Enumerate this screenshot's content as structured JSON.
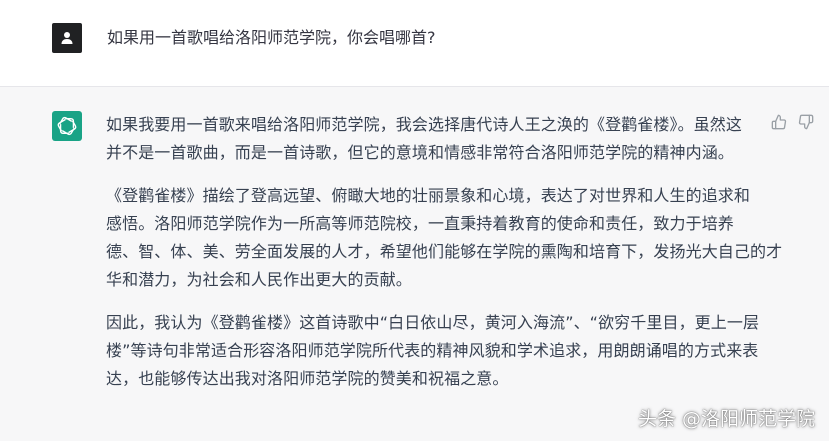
{
  "user_message": {
    "text": "如果用一首歌唱给洛阳师范学院，你会唱哪首?"
  },
  "assistant_message": {
    "paragraphs": [
      {
        "lines": [
          "如果我要用一首歌来唱给洛阳师范学院，我会选择唐代诗人王之涣的《登鹳雀楼》。虽然这",
          "并不是一首歌曲，而是一首诗歌，但它的意境和情感非常符合洛阳师范学院的精神内涵。"
        ]
      },
      {
        "lines": [
          "《登鹳雀楼》描绘了登高远望、俯瞰大地的壮丽景象和心境，表达了对世界和人生的追求和",
          "感悟。洛阳师范学院作为一所高等师范院校，一直秉持着教育的使命和责任，致力于培养",
          "德、智、体、美、劳全面发展的人才，希望他们能够在学院的熏陶和培育下，发扬光大自己的才",
          "华和潜力，为社会和人民作出更大的贡献。"
        ]
      },
      {
        "lines": [
          "因此，我认为《登鹳雀楼》这首诗歌中“白日依山尽，黄河入海流”、“欲穷千里目，更上一层",
          "楼”等诗句非常适合形容洛阳师范学院所代表的精神风貌和学术追求，用朗朗诵唱的方式来表",
          "达，也能够传达出我对洛阳师范学院的赞美和祝福之意。"
        ]
      }
    ]
  },
  "feedback": {
    "thumbs_up_icon": "thumbs-up-icon",
    "thumbs_down_icon": "thumbs-down-icon"
  },
  "watermark": {
    "text": "头条 @洛阳师范学院"
  },
  "colors": {
    "user_avatar_bg": "#202123",
    "assistant_avatar_bg": "#19a386",
    "assistant_row_bg": "#f7f7f8"
  }
}
